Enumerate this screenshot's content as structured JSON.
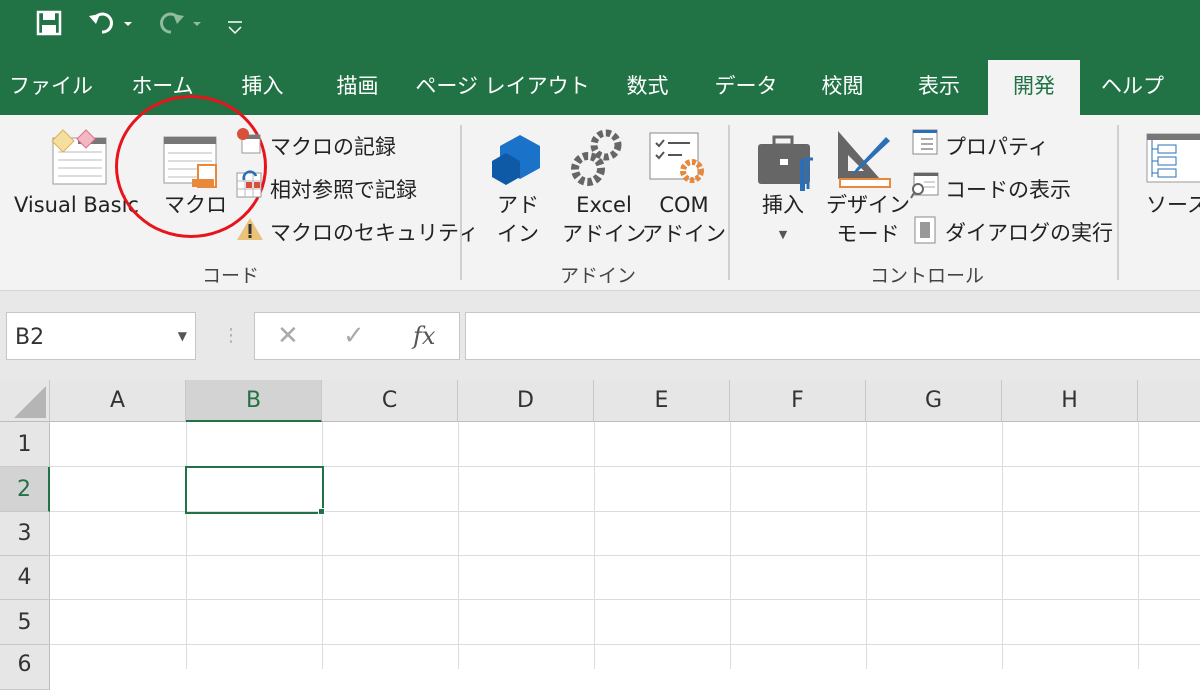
{
  "quick_access": {
    "save": "save-icon",
    "undo": "undo-icon",
    "redo": "redo-icon",
    "customize": "customize-icon"
  },
  "tabs": [
    "ファイル",
    "ホーム",
    "挿入",
    "描画",
    "ページ レイアウト",
    "数式",
    "データ",
    "校閲",
    "表示",
    "開発",
    "ヘルプ"
  ],
  "active_tab": "開発",
  "ribbon": {
    "code": {
      "group": "コード",
      "visual_basic": "Visual Basic",
      "macro": "マクロ",
      "record": "マクロの記録",
      "relative": "相対参照で記録",
      "security": "マクロのセキュリティ"
    },
    "addins": {
      "group": "アドイン",
      "addin": [
        "アド",
        "イン"
      ],
      "excel_addin": [
        "Excel",
        "アドイン"
      ],
      "com_addin": [
        "COM",
        "アドイン"
      ]
    },
    "controls": {
      "group": "コントロール",
      "insert": "挿入",
      "design_mode": [
        "デザイン",
        "モード"
      ],
      "properties": "プロパティ",
      "view_code": "コードの表示",
      "run_dialog": "ダイアログの実行"
    },
    "source": "ソース"
  },
  "annotation_color": "#e8141c",
  "formula_bar": {
    "name_box": "B2",
    "fx": "fx",
    "formula": ""
  },
  "columns": [
    "A",
    "B",
    "C",
    "D",
    "E",
    "F",
    "G",
    "H"
  ],
  "rows": [
    "1",
    "2",
    "3",
    "4",
    "5",
    "6"
  ],
  "selected_cell": "B2",
  "accent": "#217346"
}
